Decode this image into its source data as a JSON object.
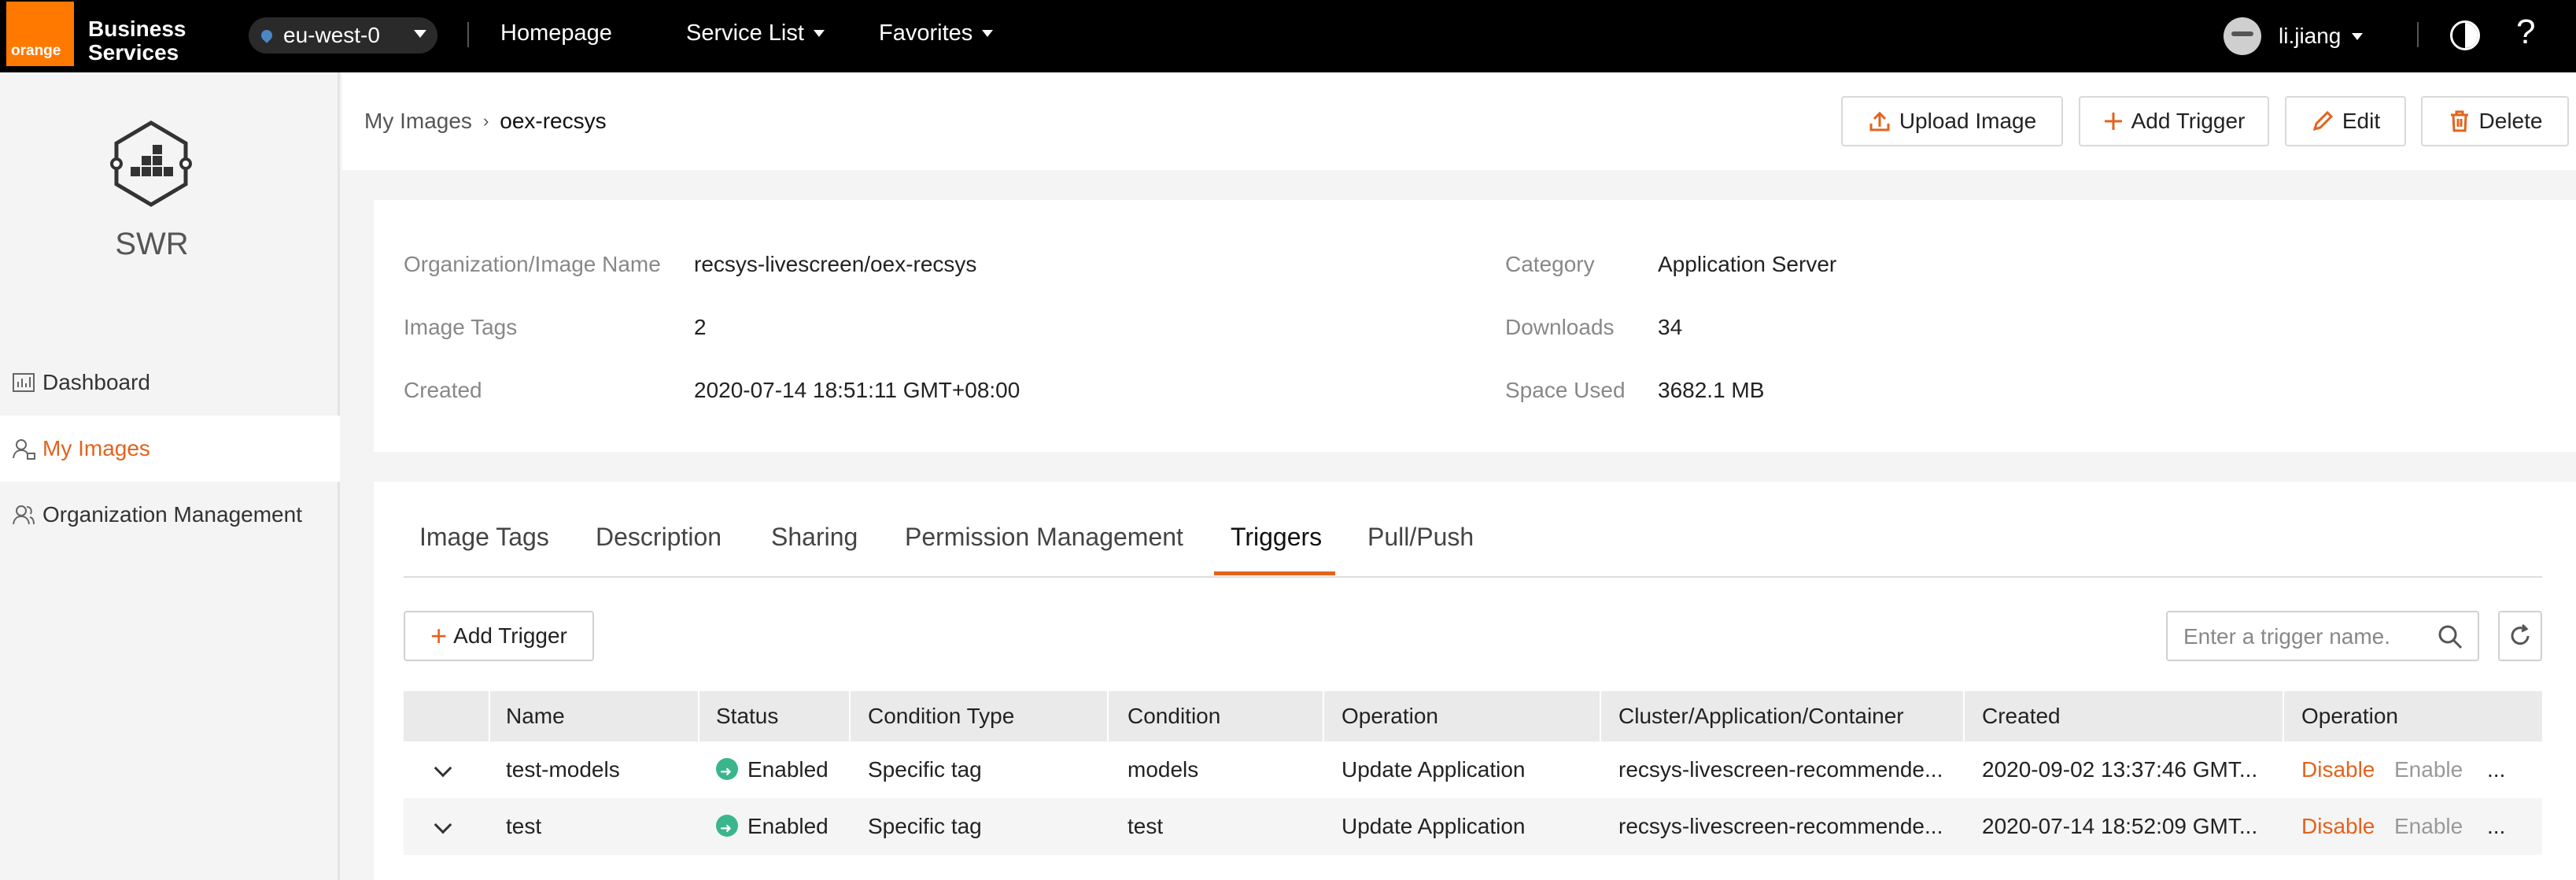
{
  "topbar": {
    "logo_text": "orange",
    "brand_line1": "Business",
    "brand_line2": "Services",
    "region": "eu-west-0",
    "nav": [
      "Homepage",
      "Service List",
      "Favorites"
    ],
    "user": "li.jiang",
    "help": "?"
  },
  "sidebar": {
    "service": "SWR",
    "items": [
      {
        "label": "Dashboard",
        "icon": "dashboard-icon"
      },
      {
        "label": "My Images",
        "icon": "images-icon",
        "active": true
      },
      {
        "label": "Organization Management",
        "icon": "organization-icon"
      }
    ]
  },
  "breadcrumb": {
    "parent": "My Images",
    "current": "oex-recsys"
  },
  "toolbar": {
    "upload": "Upload Image",
    "add_trigger": "Add Trigger",
    "edit": "Edit",
    "delete": "Delete"
  },
  "info": {
    "org_image_label": "Organization/Image Name",
    "org_image_value": "recsys-livescreen/oex-recsys",
    "tags_label": "Image Tags",
    "tags_value": "2",
    "created_label": "Created",
    "created_value": "2020-07-14 18:51:11 GMT+08:00",
    "category_label": "Category",
    "category_value": "Application Server",
    "downloads_label": "Downloads",
    "downloads_value": "34",
    "space_label": "Space Used",
    "space_value": "3682.1 MB"
  },
  "tabs": [
    "Image Tags",
    "Description",
    "Sharing",
    "Permission Management",
    "Triggers",
    "Pull/Push"
  ],
  "active_tab": "Triggers",
  "triggers": {
    "add_button": "Add Trigger",
    "search_placeholder": "Enter a trigger name.",
    "columns": [
      "Name",
      "Status",
      "Condition Type",
      "Condition",
      "Operation",
      "Cluster/Application/Container",
      "Created",
      "Operation"
    ],
    "rows": [
      {
        "name": "test-models",
        "status": "Enabled",
        "condition_type": "Specific tag",
        "condition": "models",
        "operation": "Update Application",
        "target": "recsys-livescreen-recommende...",
        "created": "2020-09-02 13:37:46 GMT...",
        "op_disable": "Disable",
        "op_enable": "Enable",
        "more": "..."
      },
      {
        "name": "test",
        "status": "Enabled",
        "condition_type": "Specific tag",
        "condition": "test",
        "operation": "Update Application",
        "target": "recsys-livescreen-recommende...",
        "created": "2020-07-14 18:52:09 GMT...",
        "op_disable": "Disable",
        "op_enable": "Enable",
        "more": "..."
      }
    ]
  },
  "colors": {
    "accent": "#e2631d",
    "logo": "#ff7900",
    "success": "#3bb58c"
  }
}
